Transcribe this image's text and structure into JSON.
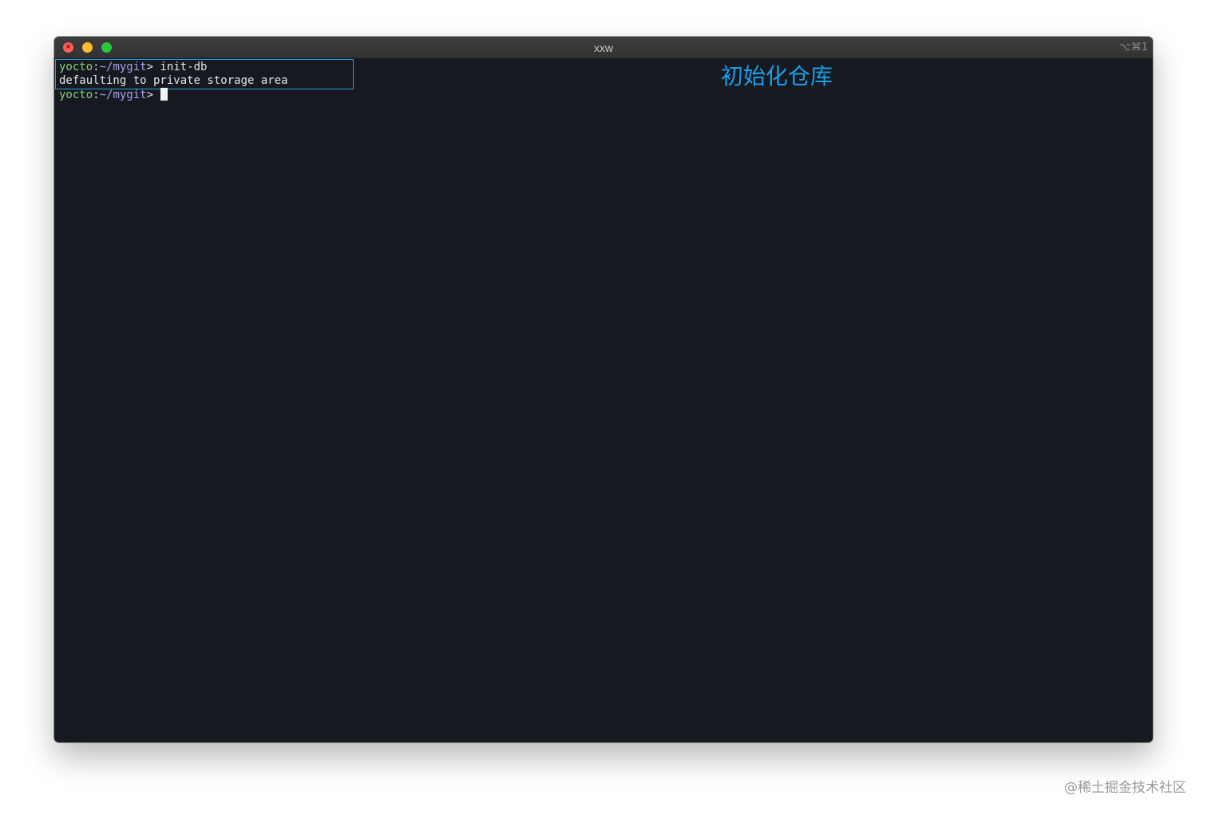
{
  "window": {
    "title": "xxw",
    "shortcut": "⌥⌘1",
    "controls": {
      "close_glyph": "×",
      "close_color": "#fe5f57",
      "minimize_color": "#febc2e",
      "zoom_color": "#28c840"
    }
  },
  "terminal": {
    "background": "#161a20",
    "lines": [
      {
        "host": "yocto",
        "separator": ":",
        "path": "~/mygit",
        "prompt_symbol": ">",
        "command": " init-db"
      },
      {
        "output": "defaulting to private storage area"
      },
      {
        "host": "yocto",
        "separator": ":",
        "path": "~/mygit",
        "prompt_symbol": ">",
        "command": " "
      }
    ]
  },
  "annotation": {
    "label": "初始化仓库",
    "color": "#1a9ee8"
  },
  "watermark": {
    "text": "@稀土掘金技术社区"
  }
}
